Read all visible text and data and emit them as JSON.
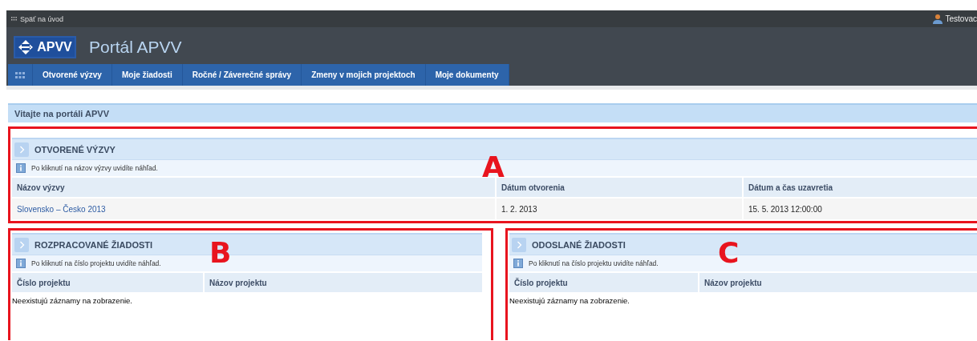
{
  "top_bar": {
    "back_link": "Späť na úvod",
    "user": "Testovac"
  },
  "header": {
    "logo": "APVV",
    "title": "Portál APVV"
  },
  "nav": [
    {
      "label": "Otvorené výzvy",
      "selected": false
    },
    {
      "label": "Moje žiadosti",
      "selected": false
    },
    {
      "label": "Ročné / Záverečné správy",
      "selected": false
    },
    {
      "label": "Zmeny v mojich projektoch",
      "selected": false
    },
    {
      "label": "Moje dokumenty",
      "selected": false
    }
  ],
  "welcome": "Vitajte na portáli APVV",
  "sections": [
    {
      "annotation": "A",
      "title": "OTVORENÉ VÝZVY",
      "hint": "Po kliknutí na názov výzvy uvidíte náhľad.",
      "columns": [
        "Názov výzvy",
        "Dátum otvorenia",
        "Dátum a čas uzavretia"
      ],
      "rows": [
        [
          {
            "kind": "link",
            "text": "Slovensko – Česko 2013"
          },
          {
            "kind": "text",
            "text": "1. 2. 2013"
          },
          {
            "kind": "text",
            "text": "15. 5. 2013 12:00:00"
          }
        ]
      ]
    },
    {
      "annotation": "B",
      "title": "ROZPRACOVANÉ ŽIADOSTI",
      "hint": "Po kliknutí na číslo projektu uvidíte náhľad.",
      "columns": [
        "Číslo projektu",
        "Názov projektu"
      ],
      "empty_message": "Neexistujú záznamy na zobrazenie."
    },
    {
      "annotation": "C",
      "title": "ODOSLANÉ ŽIADOSTI",
      "hint": "Po kliknutí na číslo projektu uvidíte náhľad.",
      "columns": [
        "Číslo projektu",
        "Názov projektu"
      ],
      "empty_message": "Neexistujú záznamy na zobrazenie."
    }
  ]
}
